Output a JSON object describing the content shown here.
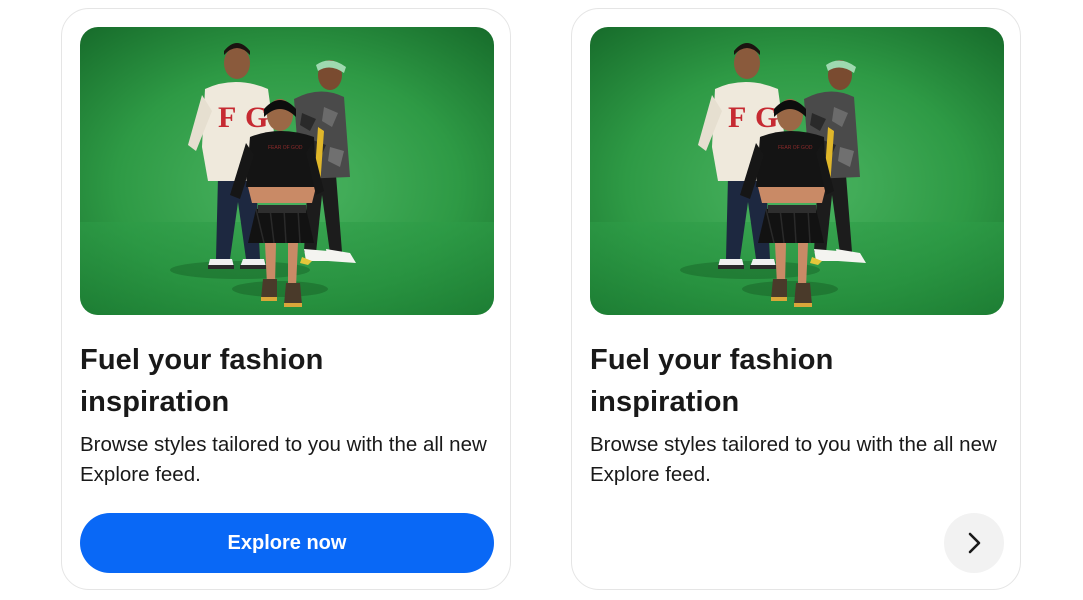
{
  "cards": [
    {
      "title": "Fuel your fashion inspiration",
      "description": "Browse styles tailored to you with the all new Explore feed.",
      "cta_label": "Explore now",
      "image_alt": "Three models posing on a green backdrop"
    },
    {
      "title": "Fuel your fashion inspiration",
      "description": "Browse styles tailored to you with the all new Explore feed.",
      "image_alt": "Three models posing on a green backdrop",
      "next_icon": "chevron-right-icon"
    }
  ],
  "colors": {
    "cta_bg": "#0968f6",
    "hero_green": "#2e9a45",
    "arrow_bg": "#f2f2f2",
    "text": "#191919",
    "border": "#e5e5e5"
  }
}
